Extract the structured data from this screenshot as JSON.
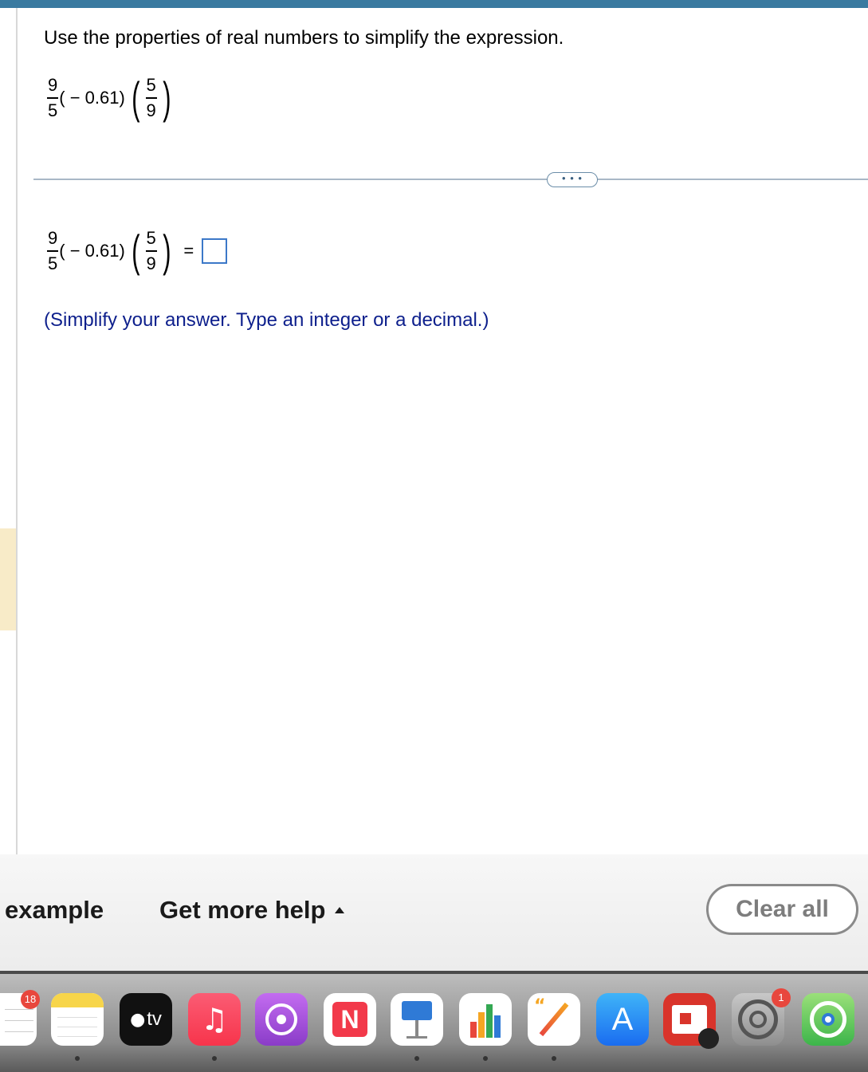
{
  "question": {
    "instruction": "Use the properties of real numbers to simplify the expression."
  },
  "expression": {
    "frac1_num": "9",
    "frac1_den": "5",
    "middle": "( − 0.61)",
    "frac2_num": "5",
    "frac2_den": "9"
  },
  "answer_row": {
    "equals": "=",
    "hint": "(Simplify your answer. Type an integer or a decimal.)"
  },
  "more_button": "• • •",
  "footer": {
    "example_label": "example",
    "help_label": "Get more help",
    "clear_label": "Clear all"
  },
  "dock": {
    "calendar_badge": "18",
    "tv_label": "tv",
    "settings_badge": "1",
    "apps": [
      "calendar-icon",
      "notes-icon",
      "apple-tv-icon",
      "music-icon",
      "podcasts-icon",
      "news-icon",
      "keynote-icon",
      "numbers-icon",
      "pages-icon",
      "app-store-icon",
      "photo-booth-icon",
      "system-settings-icon",
      "find-my-icon"
    ]
  },
  "colors": {
    "accent": "#3a7aa0",
    "hint_text": "#0d1f8c",
    "answer_box_border": "#3c78c8"
  }
}
